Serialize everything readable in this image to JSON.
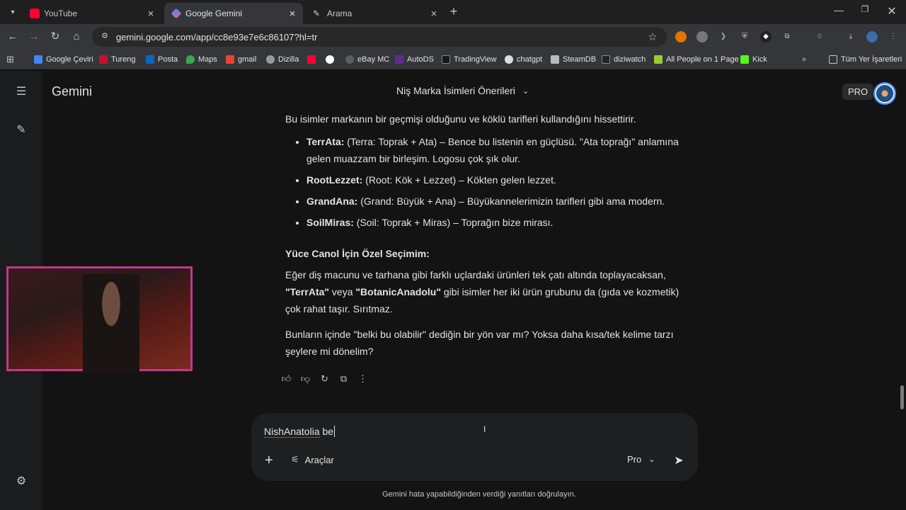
{
  "browser": {
    "tabs": [
      {
        "title": "YouTube",
        "favicon": "youtube-icon",
        "active": false
      },
      {
        "title": "Google Gemini",
        "favicon": "gemini-icon",
        "active": true
      },
      {
        "title": "Arama",
        "favicon": "search-icon",
        "active": false
      }
    ],
    "url": "gemini.google.com/app/cc8e93e7e6c86107?hl=tr",
    "bookmarks": [
      {
        "label": "Google Çeviri"
      },
      {
        "label": "Tureng"
      },
      {
        "label": "Posta"
      },
      {
        "label": "Maps"
      },
      {
        "label": "gmail"
      },
      {
        "label": "Dizilla"
      },
      {
        "label": ""
      },
      {
        "label": ""
      },
      {
        "label": "eBay MC"
      },
      {
        "label": "AutoDS"
      },
      {
        "label": "TradingView"
      },
      {
        "label": "chatgpt"
      },
      {
        "label": "SteamDB"
      },
      {
        "label": "diziwatch"
      },
      {
        "label": "All People on 1 Page"
      },
      {
        "label": "Kick"
      }
    ],
    "all_bookmarks": "Tüm Yer İşaretleri"
  },
  "app": {
    "brand": "Gemini",
    "conversation_title": "Niş Marka İsimleri Önerileri",
    "plan_badge": "PRO"
  },
  "response": {
    "intro": "Bu isimler markanın bir geçmişi olduğunu ve köklü tarifleri kullandığını hissettirir.",
    "items": [
      {
        "name": "TerrAta:",
        "text": " (Terra: Toprak + Ata) – Bence bu listenin en güçlüsü. \"Ata toprağı\" anlamına gelen muazzam bir birleşim. Logosu çok şık olur."
      },
      {
        "name": "RootLezzet:",
        "text": " (Root: Kök + Lezzet) – Kökten gelen lezzet."
      },
      {
        "name": "GrandAna:",
        "text": " (Grand: Büyük + Ana) – Büyükannelerimizin tarifleri gibi ama modern."
      },
      {
        "name": "SoilMiras:",
        "text": " (Soil: Toprak + Miras) – Toprağın bize mirası."
      }
    ],
    "special_heading": "Yüce Canol İçin Özel Seçimim:",
    "special_text_1": "Eğer diş macunu ve tarhana gibi farklı uçlardaki ürünleri tek çatı altında toplayacaksan,",
    "special_bold_1": "\"TerrAta\"",
    "special_text_2": " veya ",
    "special_bold_2": "\"BotanicAnadolu\"",
    "special_text_3": " gibi isimler her iki ürün grubunu da (gıda ve kozmetik) çok rahat taşır. Sırıtmaz.",
    "closing": "Bunların içinde \"belki bu olabilir\" dediğin bir yön var mı? Yoksa daha kısa/tek kelime tarzı şeylere mi dönelim?"
  },
  "composer": {
    "typed_misspelled": "NishAnatolia",
    "typed_rest": " be",
    "tools_label": "Araçlar",
    "model_label": "Pro"
  },
  "disclaimer": "Gemini hata yapabildiğinden verdiği yanıtları doğrulayın."
}
